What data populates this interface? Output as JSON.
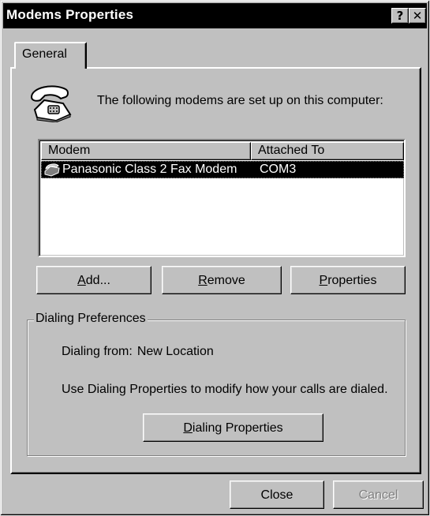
{
  "window": {
    "title": "Modems Properties",
    "help_button": "?",
    "close_button": "✕"
  },
  "tabs": [
    {
      "label": "General",
      "selected": true
    }
  ],
  "intro_text": "The following modems are set up on this computer:",
  "modem_list": {
    "columns": [
      "Modem",
      "Attached To"
    ],
    "rows": [
      {
        "name": "Panasonic Class 2 Fax Modem",
        "port": "COM3",
        "selected": true
      }
    ]
  },
  "buttons": {
    "add": {
      "mnemonic": "A",
      "rest": "dd..."
    },
    "remove": {
      "mnemonic": "R",
      "rest": "emove"
    },
    "properties": {
      "mnemonic": "P",
      "rest": "roperties"
    },
    "dialing_properties": {
      "mnemonic": "D",
      "rest": "ialing Properties"
    },
    "close": "Close",
    "cancel": "Cancel"
  },
  "dialing_preferences": {
    "group_label": "Dialing Preferences",
    "dialing_from_label": "Dialing from:",
    "dialing_from_value": "New Location",
    "note": "Use Dialing Properties to modify how your calls are dialed."
  },
  "icons": {
    "phone": "telephone-icon",
    "modem": "modem-icon"
  },
  "colors": {
    "face": "#c0c0c0",
    "shadow": "#808080",
    "selection": "#000000",
    "titlebar": "#000000"
  }
}
